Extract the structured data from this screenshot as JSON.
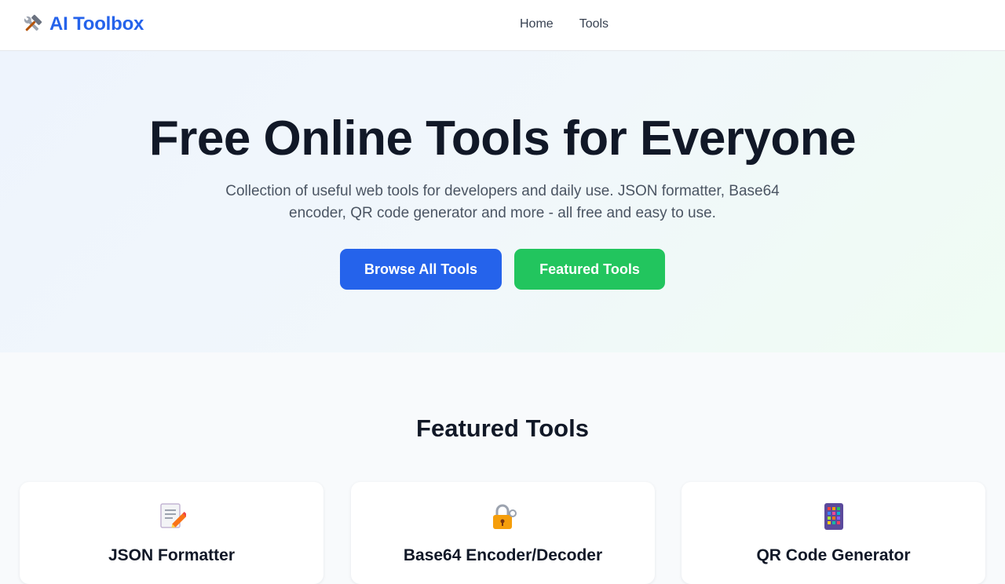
{
  "nav": {
    "brand": "AI Toolbox",
    "brand_icon": "tools-icon",
    "links": [
      {
        "label": "Home"
      },
      {
        "label": "Tools"
      }
    ]
  },
  "hero": {
    "title": "Free Online Tools for Everyone",
    "subtitle": "Collection of useful web tools for developers and daily use. JSON formatter, Base64 encoder, QR code generator and more - all free and easy to use.",
    "primary_button": "Browse All Tools",
    "secondary_button": "Featured Tools"
  },
  "featured": {
    "title": "Featured Tools",
    "cards": [
      {
        "title": "JSON Formatter",
        "icon": "memo-icon"
      },
      {
        "title": "Base64 Encoder/Decoder",
        "icon": "lock-key-icon"
      },
      {
        "title": "QR Code Generator",
        "icon": "qr-grid-icon"
      }
    ]
  },
  "colors": {
    "brand": "#2563eb",
    "primary": "#2563eb",
    "success": "#22c55e",
    "text": "#111827",
    "muted": "#4b5563"
  }
}
